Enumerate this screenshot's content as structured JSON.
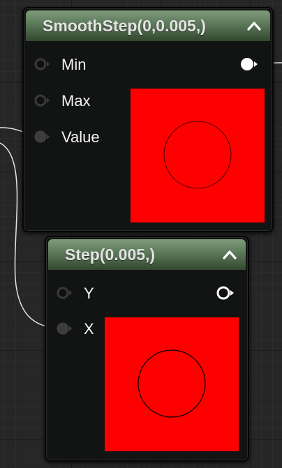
{
  "nodes": {
    "smoothstep": {
      "title": "SmoothStep(0,0.005,)",
      "pins": {
        "min": "Min",
        "max": "Max",
        "value": "Value"
      },
      "preview_color": "#ff0000"
    },
    "step": {
      "title": "Step(0.005,)",
      "pins": {
        "y": "Y",
        "x": "X"
      },
      "preview_color": "#ff0000"
    }
  },
  "colors": {
    "canvas_bg": "#262626",
    "node_bg": "#121313",
    "header_green": "#5b7858",
    "wire": "#e6e6e6",
    "preview_red": "#ff0000"
  },
  "icons": [
    "collapse-icon",
    "pin-icon",
    "output-pin-icon"
  ]
}
